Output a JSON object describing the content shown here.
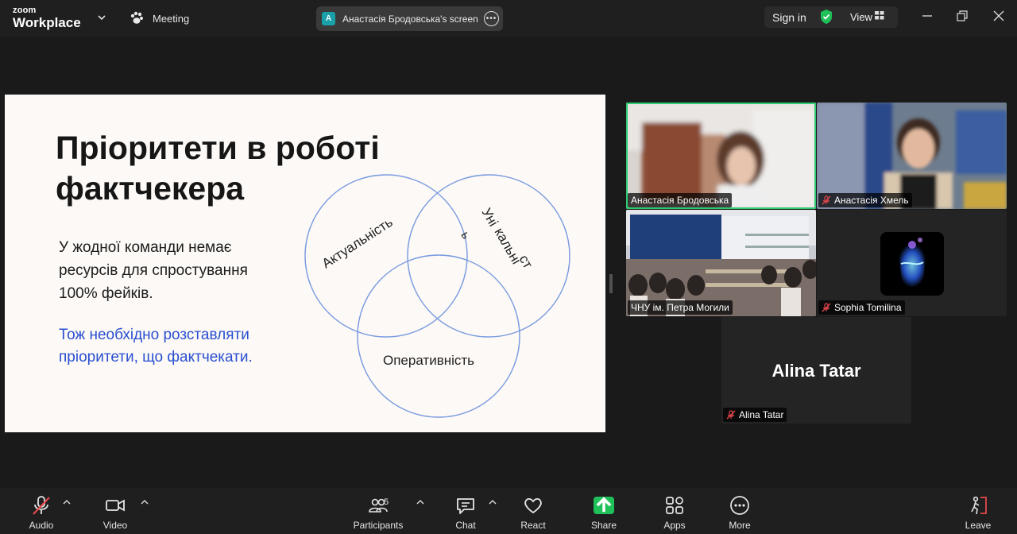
{
  "app": {
    "logo_line1": "zoom",
    "logo_line2": "Workplace",
    "meeting_label": "Meeting",
    "screen_share": {
      "avatar_letter": "A",
      "label": "Анастасія Бродовська's screen"
    },
    "sign_in": "Sign in",
    "view_label": "View"
  },
  "slide": {
    "title": "Пріоритети в роботі фактчекера",
    "paragraph1": "У жодної команди немає ресурсів для спростування 100% фейків.",
    "paragraph2": "Тож необхідно розставляти пріоритети, що фактчекати.",
    "venn_labels": {
      "relevance": "Актуальність",
      "uniqueness_part1": "Уні",
      "uniqueness_part2": "кальні",
      "uniqueness_part3": "ст",
      "uniqueness_part4": "ь",
      "speed": "Оперативність"
    }
  },
  "gallery": {
    "tiles": [
      {
        "name": "Анастасія Бродовська",
        "muted": false,
        "active": true
      },
      {
        "name": "Анастасія Хмель",
        "muted": true
      },
      {
        "name": "ЧНУ ім. Петра Могили",
        "muted": false
      },
      {
        "name": "Sophia Tomilina",
        "muted": true
      },
      {
        "name": "Alina Tatar",
        "muted": true,
        "display_name": "Alina Tatar"
      }
    ]
  },
  "toolbar": {
    "audio": "Audio",
    "video": "Video",
    "participants": "Participants",
    "participants_count": "5",
    "chat": "Chat",
    "react": "React",
    "share": "Share",
    "apps": "Apps",
    "more": "More",
    "leave": "Leave"
  },
  "colors": {
    "active_speaker": "#2ecc71",
    "share_green": "#1fbf5a",
    "muted_red": "#e5484d",
    "slide_accent_blue": "#2a4fd0",
    "venn_circle": "#6b8fd6"
  }
}
